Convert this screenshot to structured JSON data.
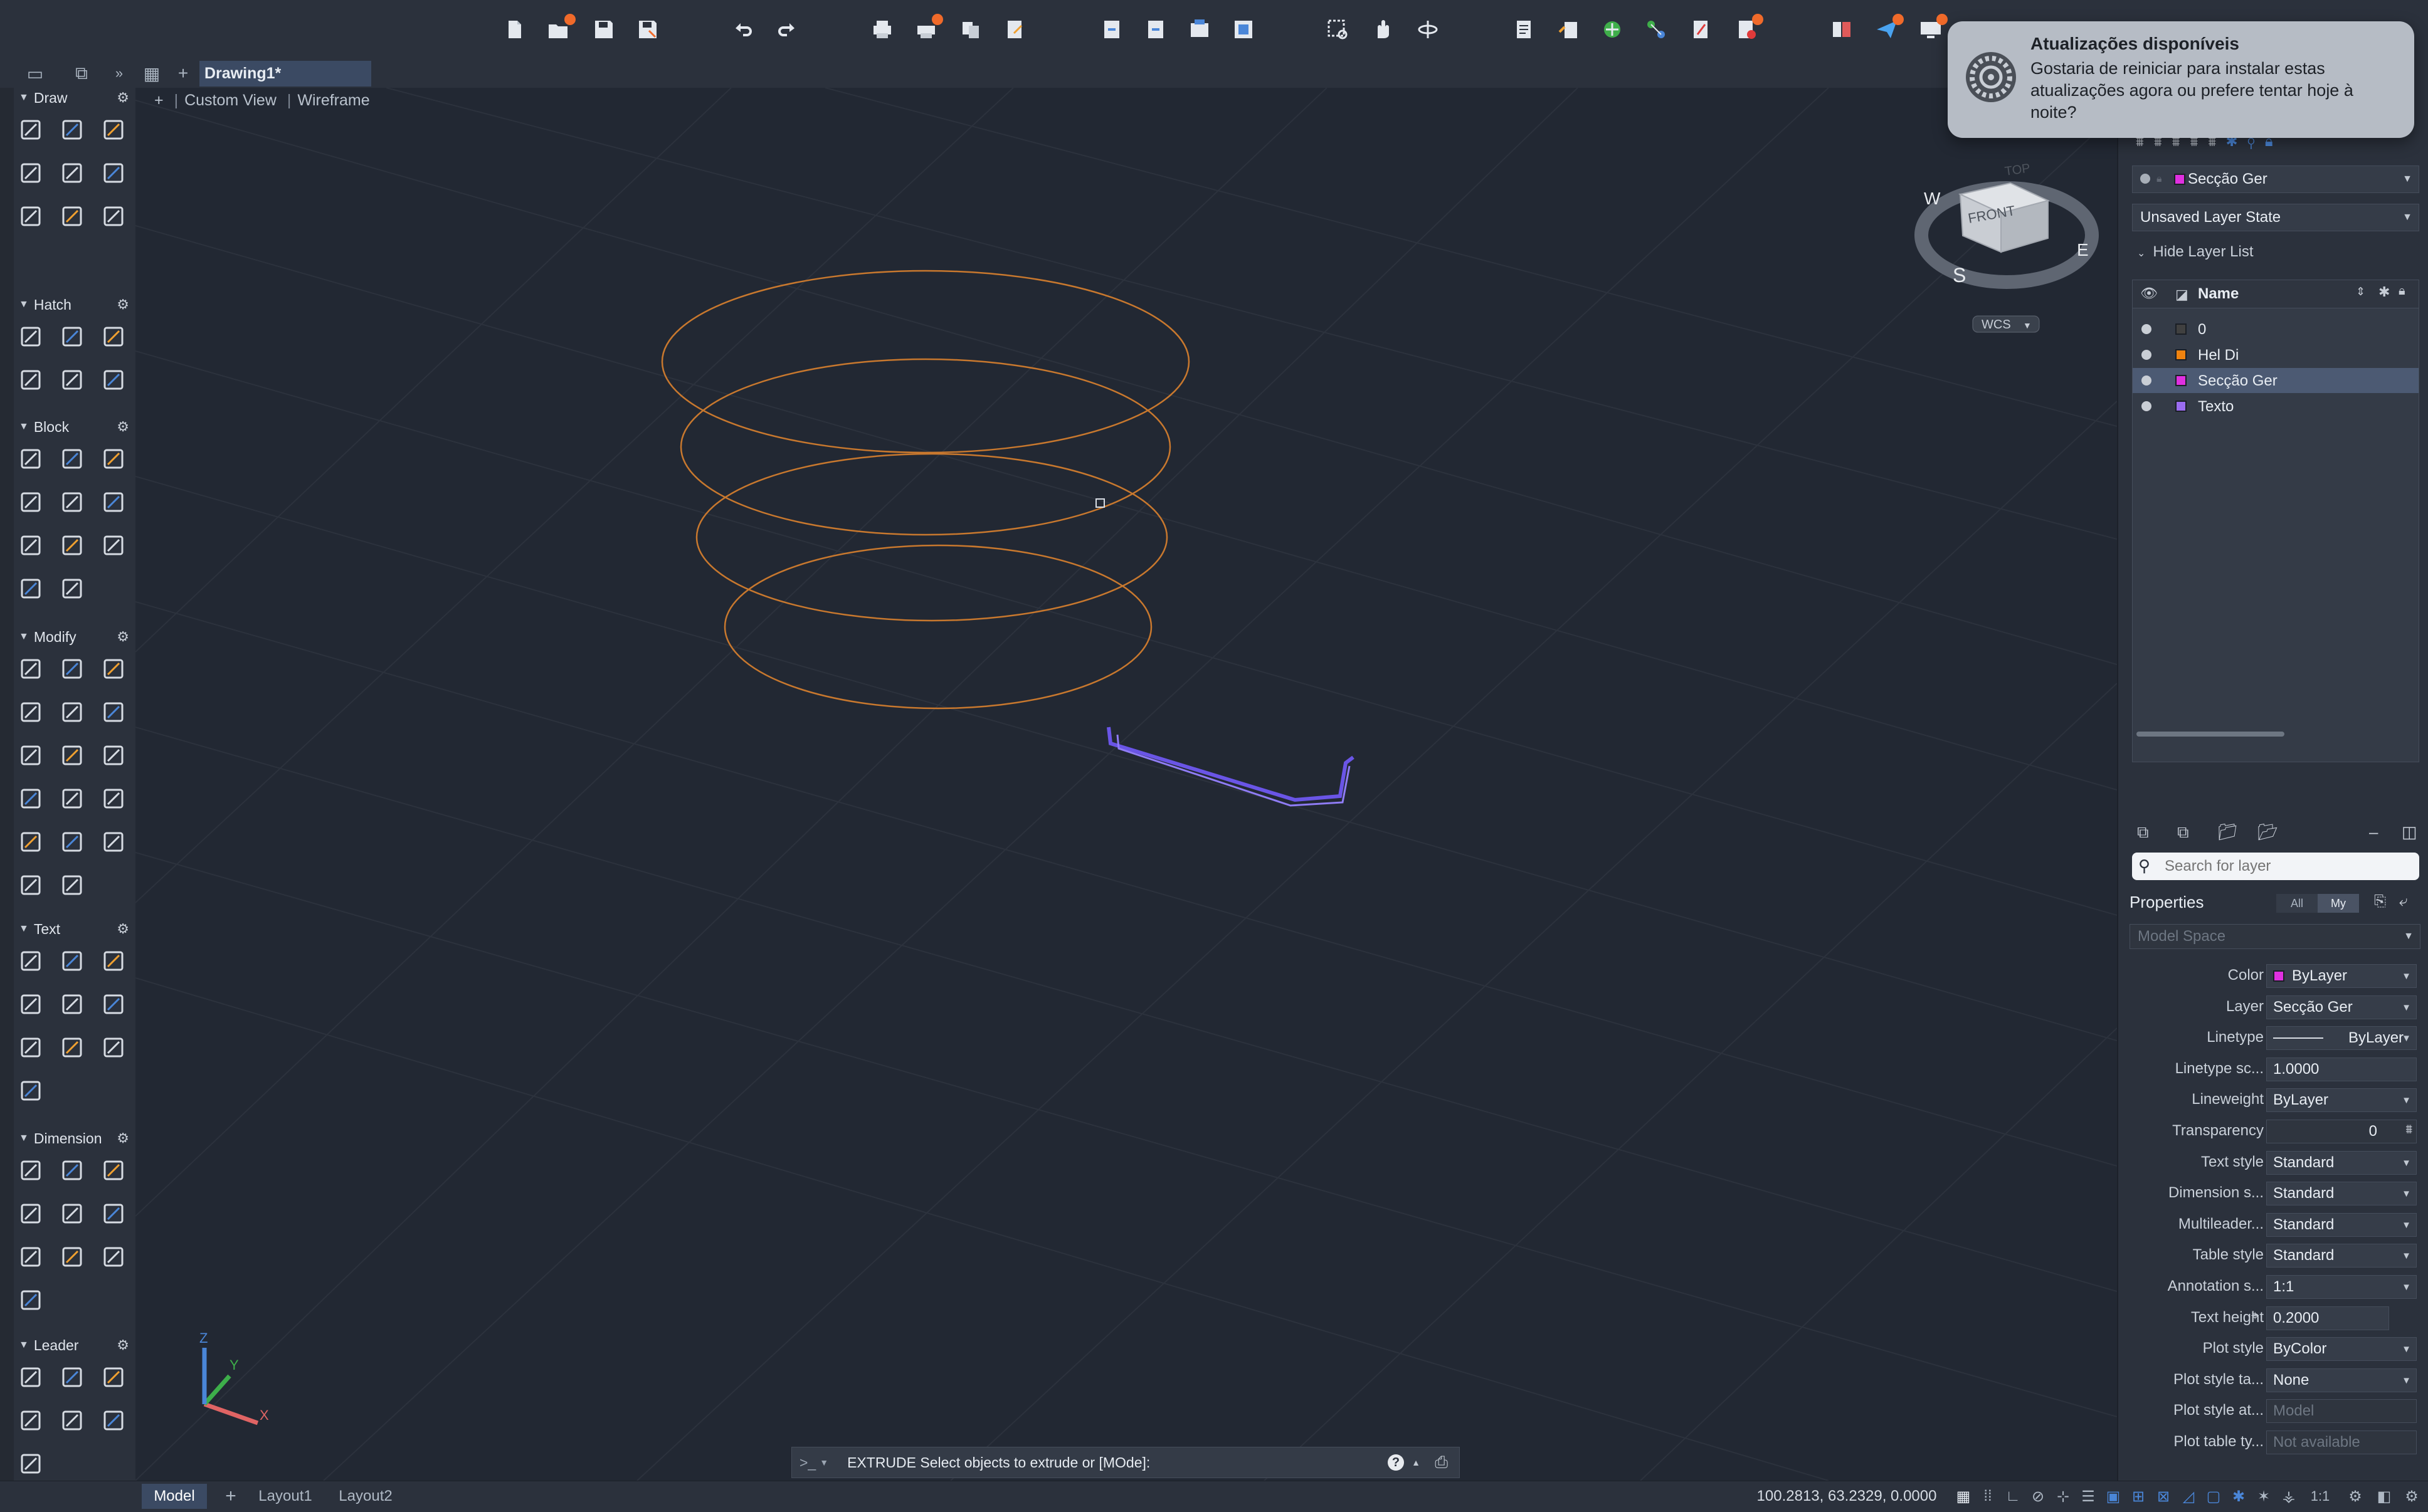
{
  "app": {
    "document_tab": "Drawing1*",
    "new_tab_symbol": "+"
  },
  "viewport": {
    "label_plus": "+",
    "view_label": "Custom View",
    "visual_style": "Wireframe",
    "viewcube": {
      "top": "TOP",
      "front": "FRONT",
      "compass": [
        "W",
        "S",
        "E"
      ],
      "wcs": "WCS"
    },
    "ucs": {
      "x": "X",
      "y": "Y",
      "z": "Z"
    }
  },
  "palette": {
    "sections": [
      {
        "id": "draw",
        "label": "Draw"
      },
      {
        "id": "hatch",
        "label": "Hatch"
      },
      {
        "id": "block",
        "label": "Block"
      },
      {
        "id": "modify",
        "label": "Modify"
      },
      {
        "id": "text",
        "label": "Text"
      },
      {
        "id": "dimension",
        "label": "Dimension"
      },
      {
        "id": "leader",
        "label": "Leader"
      }
    ]
  },
  "command": {
    "prompt_symbol": ">_",
    "text": "EXTRUDE Select objects to extrude or [MOde]:"
  },
  "status": {
    "layout_tabs": [
      "Model",
      "Layout1",
      "Layout2"
    ],
    "coordinates": "100.2813, 63.2329, 0.0000",
    "scale": "1:1"
  },
  "layers_panel": {
    "current_layer": "Secção Ger",
    "layer_state": "Unsaved Layer State",
    "hide_list_label": "Hide Layer List",
    "column_name": "Name",
    "layers": [
      {
        "name": "0",
        "color": "#404040"
      },
      {
        "name": "Hel Di",
        "color": "#f0830f"
      },
      {
        "name": "Secção Ger",
        "color": "#e030e0"
      },
      {
        "name": "Texto",
        "color": "#9a6cf0"
      }
    ],
    "search_placeholder": "Search for layer"
  },
  "properties": {
    "title": "Properties",
    "filter_all": "All",
    "filter_my": "My",
    "space": "Model Space",
    "rows": [
      {
        "label": "Color",
        "value": "ByLayer"
      },
      {
        "label": "Layer",
        "value": "Secção Ger"
      },
      {
        "label": "Linetype",
        "value": "ByLayer"
      },
      {
        "label": "Linetype sc...",
        "value": "1.0000"
      },
      {
        "label": "Lineweight",
        "value": "ByLayer"
      },
      {
        "label": "Transparency",
        "value": "0"
      },
      {
        "label": "Text style",
        "value": "Standard"
      },
      {
        "label": "Dimension s...",
        "value": "Standard"
      },
      {
        "label": "Multileader...",
        "value": "Standard"
      },
      {
        "label": "Table style",
        "value": "Standard"
      },
      {
        "label": "Annotation s...",
        "value": "1:1"
      },
      {
        "label": "Text height",
        "value": "0.2000"
      },
      {
        "label": "Plot style",
        "value": "ByColor"
      },
      {
        "label": "Plot style ta...",
        "value": "None"
      },
      {
        "label": "Plot style at...",
        "value": "Model"
      },
      {
        "label": "Plot table ty...",
        "value": "Not available"
      }
    ]
  },
  "notification": {
    "title": "Atualizações disponíveis",
    "body": "Gostaria de reiniciar para instalar estas atualizações agora ou prefere tentar hoje à noite?"
  },
  "colors": {
    "helix": "#c8782e",
    "profile": "#6a55e6",
    "accent": "#4a86d8"
  }
}
